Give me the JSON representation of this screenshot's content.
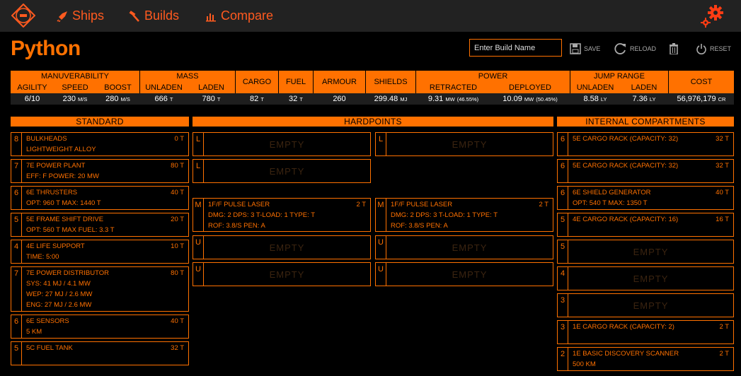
{
  "nav": {
    "ships": "Ships",
    "builds": "Builds",
    "compare": "Compare"
  },
  "ship": {
    "name": "Python"
  },
  "build_name_placeholder": "Enter Build Name",
  "toolbar": {
    "save": "SAVE",
    "reload": "RELOAD",
    "reset": "RESET"
  },
  "summary": {
    "groups": {
      "manuverability": "MANUVERABILITY",
      "mass": "MASS",
      "cargo": "CARGO",
      "fuel": "FUEL",
      "armour": "ARMOUR",
      "shields": "SHIELDS",
      "power": "POWER",
      "jump": "JUMP RANGE",
      "cost": "COST"
    },
    "sub": {
      "agility": "AGILITY",
      "speed": "SPEED",
      "boost": "BOOST",
      "unladen": "UNLADEN",
      "laden": "LADEN",
      "retracted": "RETRACTED",
      "deployed": "DEPLOYED",
      "jump_unladen": "UNLADEN",
      "jump_laden": "LADEN"
    },
    "values": {
      "agility": "6/10",
      "speed": "230",
      "speed_unit": "M/S",
      "boost": "280",
      "boost_unit": "M/S",
      "mass_unladen": "666",
      "mass_laden": "780",
      "t": "T",
      "cargo": "82",
      "fuel": "32",
      "armour": "260",
      "shields": "299.48",
      "mj": "MJ",
      "retracted": "9.31",
      "retracted_pct": "(46.55%)",
      "deployed": "10.09",
      "deployed_pct": "(50.45%)",
      "mw": "MW",
      "jump_unladen": "8.58",
      "jump_laden": "7.36",
      "ly": "LY",
      "cost": "56,976,179",
      "cr": "CR"
    }
  },
  "sections": {
    "standard": "STANDARD",
    "hardpoints": "HARDPOINTS",
    "internal": "INTERNAL COMPARTMENTS"
  },
  "empty_label": "EMPTY",
  "standard": [
    {
      "cls": "8",
      "name": "BULKHEADS",
      "mass": "0 T",
      "l2": "LIGHTWEIGHT ALLOY"
    },
    {
      "cls": "7",
      "name": "7E POWER PLANT",
      "mass": "80 T",
      "l2": "EFF: F    POWER: 20 MW"
    },
    {
      "cls": "6",
      "name": "6E THRUSTERS",
      "mass": "40 T",
      "l2": "OPT: 960 T    MAX: 1440 T"
    },
    {
      "cls": "5",
      "name": "5E FRAME SHIFT DRIVE",
      "mass": "20 T",
      "l2": "OPT: 560 T    MAX FUEL: 3.3 T"
    },
    {
      "cls": "4",
      "name": "4E LIFE SUPPORT",
      "mass": "10 T",
      "l2": "TIME: 5:00"
    },
    {
      "cls": "7",
      "name": "7E POWER DISTRIBUTOR",
      "mass": "80 T",
      "l2": "SYS: 41 MJ / 4.1 MW",
      "l3": "WEP: 27 MJ / 2.6 MW",
      "l4": "ENG: 27 MJ / 2.6 MW"
    },
    {
      "cls": "6",
      "name": "6E SENSORS",
      "mass": "40 T",
      "l2": "5 KM"
    },
    {
      "cls": "5",
      "name": "5C FUEL TANK",
      "mass": "32 T"
    }
  ],
  "hardpoints": {
    "left": [
      {
        "cls": "L"
      },
      {
        "cls": "L"
      },
      {
        "cls": "M",
        "name": "1F/F PULSE LASER",
        "mass": "2 T",
        "l2": "DMG: 2    DPS: 3    T-LOAD: 1    TYPE: T",
        "l3": "ROF: 3.8/S    PEN: A"
      },
      {
        "cls": "U"
      },
      {
        "cls": "U"
      }
    ],
    "right": [
      {
        "cls": "L"
      },
      {
        "cls": "M",
        "name": "1F/F PULSE LASER",
        "mass": "2 T",
        "l2": "DMG: 2    DPS: 3    T-LOAD: 1    TYPE: T",
        "l3": "ROF: 3.8/S    PEN: A"
      },
      {
        "cls": "U"
      },
      {
        "cls": "U"
      }
    ]
  },
  "internal": [
    {
      "cls": "6",
      "name": "5E CARGO RACK (CAPACITY: 32)",
      "mass": "32 T"
    },
    {
      "cls": "6",
      "name": "5E CARGO RACK (CAPACITY: 32)",
      "mass": "32 T"
    },
    {
      "cls": "6",
      "name": "6E SHIELD GENERATOR",
      "mass": "40 T",
      "l2": "OPT: 540 T    MAX: 1350 T"
    },
    {
      "cls": "5",
      "name": "4E CARGO RACK (CAPACITY: 16)",
      "mass": "16 T"
    },
    {
      "cls": "5"
    },
    {
      "cls": "4"
    },
    {
      "cls": "3"
    },
    {
      "cls": "3",
      "name": "1E CARGO RACK (CAPACITY: 2)",
      "mass": "2 T"
    },
    {
      "cls": "2",
      "name": "1E BASIC DISCOVERY SCANNER",
      "mass": "2 T",
      "l2": "500 KM"
    }
  ]
}
